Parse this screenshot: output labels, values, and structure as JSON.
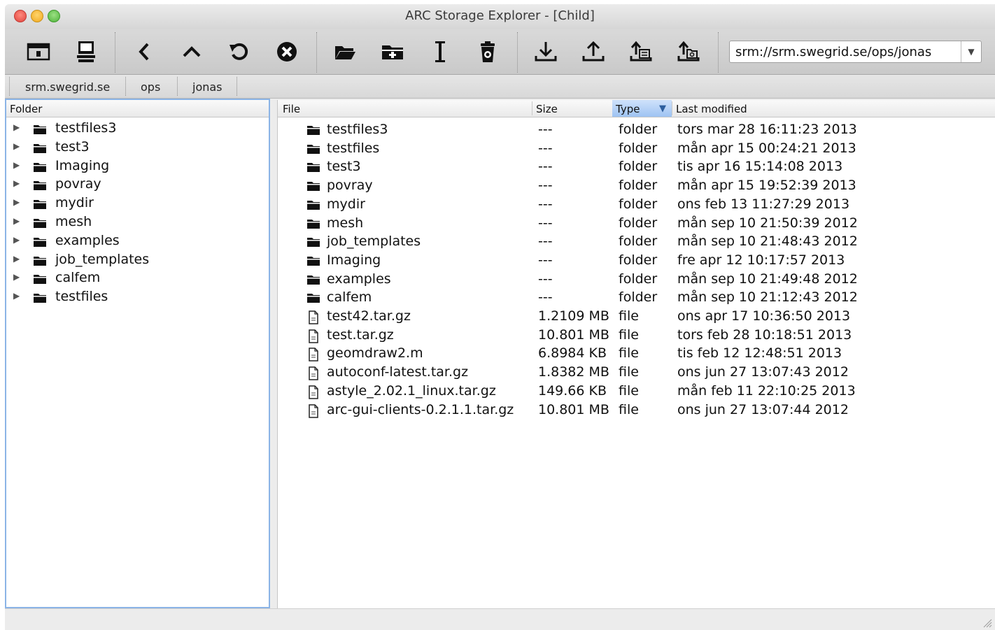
{
  "window": {
    "title": "ARC Storage Explorer - [Child]"
  },
  "toolbar": {
    "buttons": [
      {
        "name": "new-window-icon"
      },
      {
        "name": "server-icon"
      },
      {
        "name": "back-icon"
      },
      {
        "name": "up-icon"
      },
      {
        "name": "refresh-icon"
      },
      {
        "name": "stop-icon"
      },
      {
        "name": "open-folder-icon"
      },
      {
        "name": "new-folder-icon"
      },
      {
        "name": "rename-icon"
      },
      {
        "name": "delete-icon"
      },
      {
        "name": "download-icon"
      },
      {
        "name": "upload-icon"
      },
      {
        "name": "upload-file-icon"
      },
      {
        "name": "upload-directory-icon"
      }
    ],
    "url": "srm://srm.swegrid.se/ops/jonas"
  },
  "breadcrumb": [
    "srm.swegrid.se",
    "ops",
    "jonas"
  ],
  "tree": {
    "header": "Folder",
    "items": [
      "testfiles3",
      "test3",
      "Imaging",
      "povray",
      "mydir",
      "mesh",
      "examples",
      "job_templates",
      "calfem",
      "testfiles"
    ]
  },
  "files": {
    "headers": {
      "file": "File",
      "size": "Size",
      "type": "Type",
      "modified": "Last modified"
    },
    "rows": [
      {
        "name": "testfiles3",
        "size": "---",
        "type": "folder",
        "modified": "tors mar 28 16:11:23 2013",
        "kind": "folder"
      },
      {
        "name": "testfiles",
        "size": "---",
        "type": "folder",
        "modified": "mån apr 15 00:24:21 2013",
        "kind": "folder"
      },
      {
        "name": "test3",
        "size": "---",
        "type": "folder",
        "modified": "tis apr 16 15:14:08 2013",
        "kind": "folder"
      },
      {
        "name": "povray",
        "size": "---",
        "type": "folder",
        "modified": "mån apr 15 19:52:39 2013",
        "kind": "folder"
      },
      {
        "name": "mydir",
        "size": "---",
        "type": "folder",
        "modified": "ons feb 13 11:27:29 2013",
        "kind": "folder"
      },
      {
        "name": "mesh",
        "size": "---",
        "type": "folder",
        "modified": "mån sep 10 21:50:39 2012",
        "kind": "folder"
      },
      {
        "name": "job_templates",
        "size": "---",
        "type": "folder",
        "modified": "mån sep 10 21:48:43 2012",
        "kind": "folder"
      },
      {
        "name": "Imaging",
        "size": "---",
        "type": "folder",
        "modified": "fre apr 12 10:17:57 2013",
        "kind": "folder"
      },
      {
        "name": "examples",
        "size": "---",
        "type": "folder",
        "modified": "mån sep 10 21:49:48 2012",
        "kind": "folder"
      },
      {
        "name": "calfem",
        "size": "---",
        "type": "folder",
        "modified": "mån sep 10 21:12:43 2012",
        "kind": "folder"
      },
      {
        "name": "test42.tar.gz",
        "size": "1.2109 MB",
        "type": "file",
        "modified": "ons apr 17 10:36:50 2013",
        "kind": "file"
      },
      {
        "name": "test.tar.gz",
        "size": "10.801 MB",
        "type": "file",
        "modified": "tors feb 28 10:18:51 2013",
        "kind": "file"
      },
      {
        "name": "geomdraw2.m",
        "size": "6.8984 KB",
        "type": "file",
        "modified": "tis feb 12 12:48:51 2013",
        "kind": "file"
      },
      {
        "name": "autoconf-latest.tar.gz",
        "size": "1.8382 MB",
        "type": "file",
        "modified": "ons jun 27 13:07:43 2012",
        "kind": "file"
      },
      {
        "name": "astyle_2.02.1_linux.tar.gz",
        "size": "149.66 KB",
        "type": "file",
        "modified": "mån feb 11 22:10:25 2013",
        "kind": "file"
      },
      {
        "name": "arc-gui-clients-0.2.1.1.tar.gz",
        "size": "10.801 MB",
        "type": "file",
        "modified": "ons jun 27 13:07:44 2012",
        "kind": "file"
      }
    ]
  }
}
